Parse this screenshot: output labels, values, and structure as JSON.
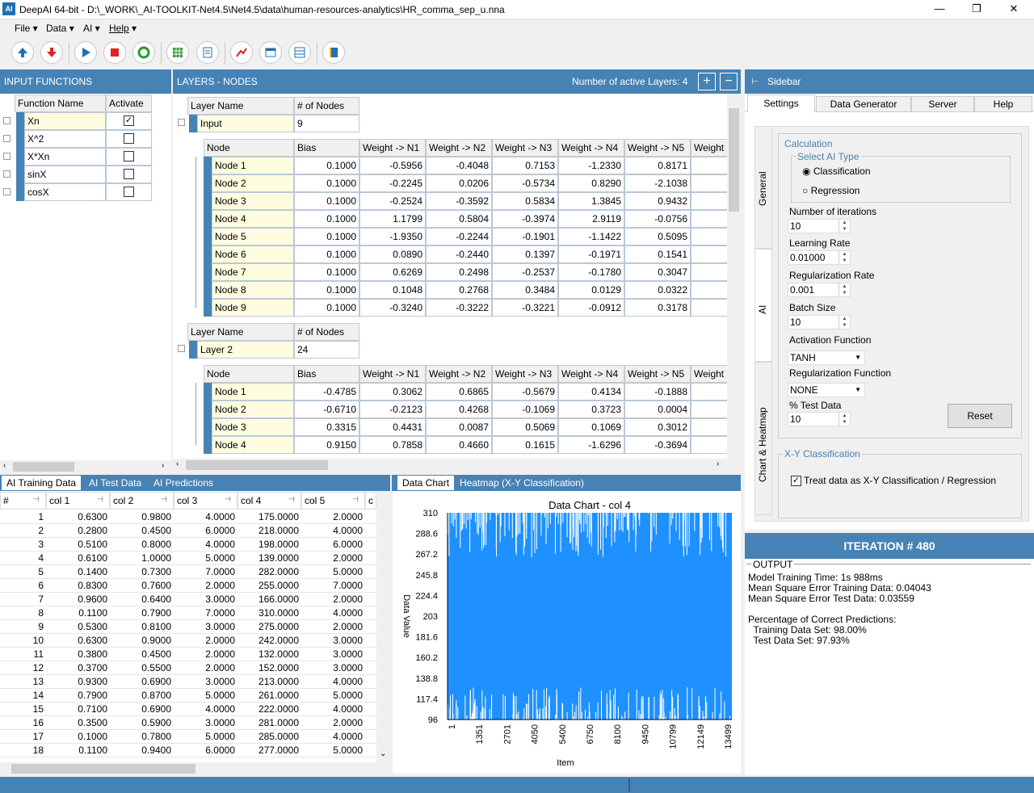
{
  "window": {
    "title": "DeepAI 64-bit - D:\\_WORK\\_AI-TOOLKIT-Net4.5\\Net4.5\\data\\human-resources-analytics\\HR_comma_sep_u.nna",
    "icon_text": "AI"
  },
  "menu": [
    {
      "label": "File"
    },
    {
      "label": "Data"
    },
    {
      "label": "AI"
    },
    {
      "label": "Help"
    }
  ],
  "input_functions": {
    "header": "INPUT FUNCTIONS",
    "col_name": "Function Name",
    "col_activate": "Activate",
    "rows": [
      {
        "name": "Xn",
        "active": true
      },
      {
        "name": "X^2",
        "active": false
      },
      {
        "name": "X*Xn",
        "active": false
      },
      {
        "name": "sinX",
        "active": false
      },
      {
        "name": "cosX",
        "active": false
      }
    ]
  },
  "layers": {
    "header": "LAYERS - NODES",
    "active_label": "Number of active Layers: 4",
    "plus": "+",
    "minus": "−",
    "layer_name_hdr": "Layer Name",
    "nodes_hdr": "# of Nodes",
    "node_cols": [
      "Node",
      "Bias",
      "Weight -> N1",
      "Weight -> N2",
      "Weight -> N3",
      "Weight -> N4",
      "Weight -> N5",
      "Weight -"
    ],
    "layer1": {
      "name": "Input",
      "count": "9",
      "rows": [
        [
          "Node 1",
          "0.1000",
          "-0.5956",
          "-0.4048",
          "0.7153",
          "-1.2330",
          "0.8171",
          "-"
        ],
        [
          "Node 2",
          "0.1000",
          "-0.2245",
          "0.0206",
          "-0.5734",
          "0.8290",
          "-2.1038",
          "-"
        ],
        [
          "Node 3",
          "0.1000",
          "-0.2524",
          "-0.3592",
          "0.5834",
          "1.3845",
          "0.9432",
          "-"
        ],
        [
          "Node 4",
          "0.1000",
          "1.1799",
          "0.5804",
          "-0.3974",
          "2.9119",
          "-0.0756",
          "-"
        ],
        [
          "Node 5",
          "0.1000",
          "-1.9350",
          "-0.2244",
          "-0.1901",
          "-1.1422",
          "0.5095",
          "-"
        ],
        [
          "Node 6",
          "0.1000",
          "0.0890",
          "-0.2440",
          "0.1397",
          "-0.1971",
          "0.1541",
          "-"
        ],
        [
          "Node 7",
          "0.1000",
          "0.6269",
          "0.2498",
          "-0.2537",
          "-0.1780",
          "0.3047",
          "-"
        ],
        [
          "Node 8",
          "0.1000",
          "0.1048",
          "0.2768",
          "0.3484",
          "0.0129",
          "0.0322",
          "-"
        ],
        [
          "Node 9",
          "0.1000",
          "-0.3240",
          "-0.3222",
          "-0.3221",
          "-0.0912",
          "0.3178",
          "-"
        ]
      ]
    },
    "layer2": {
      "name": "Layer 2",
      "count": "24",
      "rows": [
        [
          "Node 1",
          "-0.4785",
          "0.3062",
          "0.6865",
          "-0.5679",
          "0.4134",
          "-0.1888",
          "-"
        ],
        [
          "Node 2",
          "-0.6710",
          "-0.2123",
          "0.4268",
          "-0.1069",
          "0.3723",
          "0.0004",
          "-"
        ],
        [
          "Node 3",
          "0.3315",
          "0.4431",
          "0.0087",
          "0.5069",
          "0.1069",
          "0.3012",
          "-"
        ],
        [
          "Node 4",
          "0.9150",
          "0.7858",
          "0.4660",
          "0.1615",
          "-1.6296",
          "-0.3694",
          "-"
        ]
      ]
    }
  },
  "bottom_tabs": [
    {
      "label": "AI Training Data"
    },
    {
      "label": "AI Test Data"
    },
    {
      "label": "AI Predictions"
    }
  ],
  "training_table": {
    "cols": [
      "#",
      "col 1",
      "col 2",
      "col 3",
      "col 4",
      "col 5",
      "c"
    ],
    "rows": [
      [
        "1",
        "0.6300",
        "0.9800",
        "4.0000",
        "175.0000",
        "2.0000"
      ],
      [
        "2",
        "0.2800",
        "0.4500",
        "6.0000",
        "218.0000",
        "4.0000"
      ],
      [
        "3",
        "0.5100",
        "0.8000",
        "4.0000",
        "198.0000",
        "6.0000"
      ],
      [
        "4",
        "0.6100",
        "1.0000",
        "5.0000",
        "139.0000",
        "2.0000"
      ],
      [
        "5",
        "0.1400",
        "0.7300",
        "7.0000",
        "282.0000",
        "5.0000"
      ],
      [
        "6",
        "0.8300",
        "0.7600",
        "2.0000",
        "255.0000",
        "7.0000"
      ],
      [
        "7",
        "0.9600",
        "0.6400",
        "3.0000",
        "166.0000",
        "2.0000"
      ],
      [
        "8",
        "0.1100",
        "0.7900",
        "7.0000",
        "310.0000",
        "4.0000"
      ],
      [
        "9",
        "0.5300",
        "0.8100",
        "3.0000",
        "275.0000",
        "2.0000"
      ],
      [
        "10",
        "0.6300",
        "0.9000",
        "2.0000",
        "242.0000",
        "3.0000"
      ],
      [
        "11",
        "0.3800",
        "0.4500",
        "2.0000",
        "132.0000",
        "3.0000"
      ],
      [
        "12",
        "0.3700",
        "0.5500",
        "2.0000",
        "152.0000",
        "3.0000"
      ],
      [
        "13",
        "0.9300",
        "0.6900",
        "3.0000",
        "213.0000",
        "4.0000"
      ],
      [
        "14",
        "0.7900",
        "0.8700",
        "5.0000",
        "261.0000",
        "5.0000"
      ],
      [
        "15",
        "0.7100",
        "0.6900",
        "4.0000",
        "222.0000",
        "4.0000"
      ],
      [
        "16",
        "0.3500",
        "0.5900",
        "3.0000",
        "281.0000",
        "2.0000"
      ],
      [
        "17",
        "0.1000",
        "0.7800",
        "5.0000",
        "285.0000",
        "4.0000"
      ],
      [
        "18",
        "0.1100",
        "0.9400",
        "6.0000",
        "277.0000",
        "5.0000"
      ]
    ]
  },
  "chart_tabs": [
    {
      "label": "Data Chart"
    },
    {
      "label": "Heatmap (X-Y Classification)"
    }
  ],
  "chart_data": {
    "type": "bar",
    "title": "Data Chart - col 4",
    "xlabel": "Item",
    "ylabel": "Data Value",
    "ylim": [
      96,
      310
    ],
    "yticks": [
      "310",
      "288.6",
      "267.2",
      "245.8",
      "224.4",
      "203",
      "181.6",
      "160.2",
      "138.8",
      "117.4",
      "96"
    ],
    "xticks": [
      "1",
      "1351",
      "2701",
      "4050",
      "5400",
      "6750",
      "8100",
      "9450",
      "10799",
      "12149",
      "13499"
    ],
    "color": "#1e90ff"
  },
  "sidebar": {
    "header": "Sidebar",
    "tabs": [
      {
        "label": "Settings"
      },
      {
        "label": "Data Generator"
      },
      {
        "label": "Server"
      },
      {
        "label": "Help"
      }
    ],
    "vtabs": [
      {
        "label": "General"
      },
      {
        "label": "AI"
      },
      {
        "label": "Chart & Heatmap"
      }
    ],
    "calculation": "Calculation",
    "select_type": "Select AI Type",
    "classification": "Classification",
    "regression": "Regression",
    "iterations_label": "Number of iterations",
    "iterations": "10",
    "lr_label": "Learning Rate",
    "lr": "0.01000",
    "reg_rate_label": "Regularization Rate",
    "reg_rate": "0.001",
    "batch_label": "Batch Size",
    "batch": "10",
    "act_label": "Activation Function",
    "act": "TANH",
    "reg_fn_label": "Regularization Function",
    "reg_fn": "NONE",
    "test_label": "% Test Data",
    "test": "10",
    "reset": "Reset",
    "xy_group": "X-Y Classification",
    "xy_check": "Treat data as X-Y Classification / Regression"
  },
  "iteration": "ITERATION # 480",
  "output": {
    "label": "OUTPUT",
    "lines": [
      "Model Training Time: 1s 988ms",
      "Mean Square Error Training Data: 0.04043",
      "Mean Square Error Test Data: 0.03559",
      "",
      "Percentage of Correct Predictions:",
      "  Training Data Set: 98.00%",
      "  Test Data Set: 97.93%"
    ]
  }
}
